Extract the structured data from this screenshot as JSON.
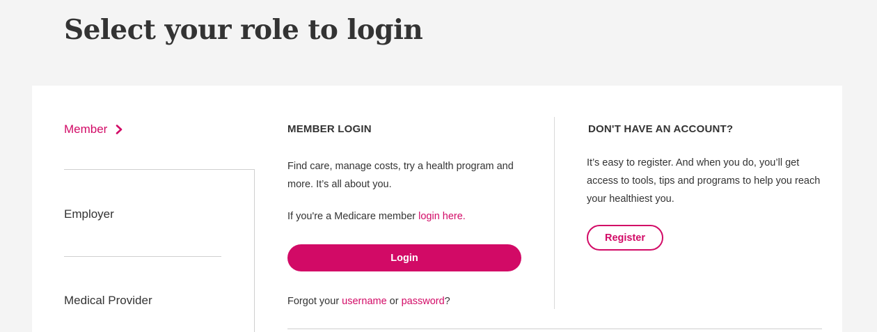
{
  "page": {
    "title": "Select your role to login"
  },
  "roles": {
    "member": "Member",
    "employer": "Employer",
    "provider": "Medical Provider"
  },
  "member_login": {
    "heading": "MEMBER LOGIN",
    "description": "Find care, manage costs, try a health program and more. It’s all about you.",
    "medicare_prefix": "If you're a Medicare member ",
    "medicare_link": "login here.",
    "login_button": "Login",
    "forgot_prefix": "Forgot your ",
    "forgot_username": "username",
    "forgot_or": " or ",
    "forgot_password": "password",
    "forgot_suffix": "?"
  },
  "register": {
    "heading": "DON'T HAVE AN ACCOUNT?",
    "description": "It’s easy to register. And when you do, you’ll get access to tools, tips and programs to help you reach your healthiest you.",
    "button": "Register"
  },
  "colors": {
    "accent": "#d20a66",
    "page_background": "#f4f4f4",
    "text": "#333333"
  },
  "icons": {
    "selected_role_indicator": "chevron-right-icon"
  }
}
